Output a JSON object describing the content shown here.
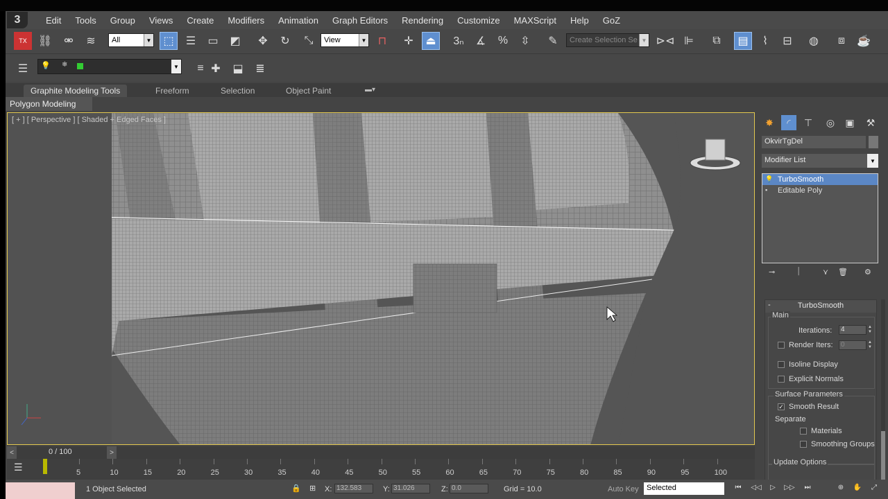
{
  "menu": {
    "logo": "3",
    "items": [
      "Edit",
      "Tools",
      "Group",
      "Views",
      "Create",
      "Modifiers",
      "Animation",
      "Graph Editors",
      "Rendering",
      "Customize",
      "MAXScript",
      "Help",
      "GoZ"
    ]
  },
  "toolbar": {
    "selection_filter": "All",
    "ref_coord": "View",
    "named_selection_placeholder": "Create Selection Se"
  },
  "ribbon": {
    "tabs": [
      "Graphite Modeling Tools",
      "Freeform",
      "Selection",
      "Object Paint"
    ],
    "sub_label": "Polygon Modeling"
  },
  "viewport": {
    "label": "[ + ] [ Perspective ] [ Shaded + Edged Faces ]"
  },
  "command_panel": {
    "object_name": "OkvirTgDel",
    "modifier_list_label": "Modifier List",
    "stack": [
      {
        "label": "TurboSmooth",
        "selected": true
      },
      {
        "label": "Editable Poly",
        "selected": false
      }
    ],
    "rollout": {
      "title": "TurboSmooth",
      "main_group": "Main",
      "iterations_label": "Iterations:",
      "iterations_value": "4",
      "render_iters_label": "Render Iters:",
      "render_iters_value": "0",
      "isoline_label": "Isoline Display",
      "explicit_normals_label": "Explicit Normals",
      "surface_group": "Surface Parameters",
      "smooth_result_label": "Smooth Result",
      "separate_label": "Separate",
      "materials_label": "Materials",
      "smoothing_groups_label": "Smoothing Groups",
      "update_group": "Update Options"
    }
  },
  "timeline": {
    "frame_text": "0 / 100",
    "ticks": [
      "5",
      "10",
      "15",
      "20",
      "25",
      "30",
      "35",
      "40",
      "45",
      "50",
      "55",
      "60",
      "65",
      "70",
      "75",
      "80",
      "85",
      "90",
      "95",
      "100"
    ]
  },
  "status": {
    "selected_text": "1 Object Selected",
    "x_label": "X:",
    "x_value": "132.583",
    "y_label": "Y:",
    "y_value": "31.026",
    "z_label": "Z:",
    "z_value": "0.0",
    "grid_text": "Grid = 10.0",
    "auto_key_label": "Auto Key",
    "key_filter": "Selected"
  },
  "colors": {
    "accent": "#5f8fcf",
    "viewport_border": "#e3c84f"
  }
}
